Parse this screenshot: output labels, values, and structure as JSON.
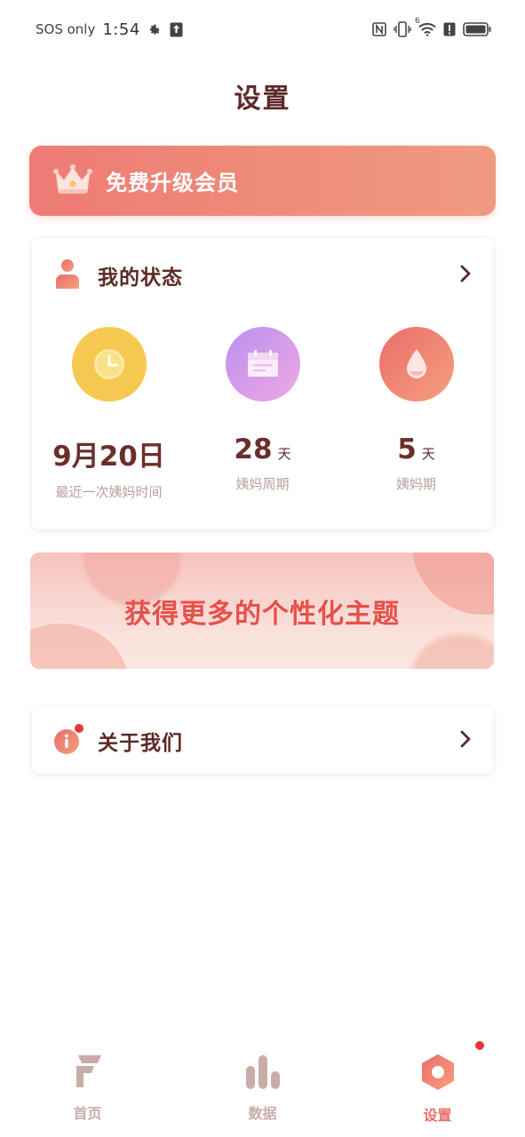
{
  "status_bar": {
    "carrier": "SOS only",
    "time": "1:54",
    "network_badge": "6"
  },
  "page": {
    "title": "设置"
  },
  "vip_banner": {
    "label": "免费升级会员"
  },
  "my_status": {
    "title": "我的状态",
    "stats": [
      {
        "value": "9月20日",
        "unit": "",
        "label": "最近一次姨妈时间",
        "icon": "clock-icon"
      },
      {
        "value": "28",
        "unit": "天",
        "label": "姨妈周期",
        "icon": "calendar-icon"
      },
      {
        "value": "5",
        "unit": "天",
        "label": "姨妈期",
        "icon": "drop-icon"
      }
    ]
  },
  "theme_banner": {
    "label": "获得更多的个性化主题"
  },
  "about": {
    "label": "关于我们"
  },
  "bottom_nav": {
    "items": [
      {
        "label": "首页",
        "icon": "home-f-icon",
        "active": false
      },
      {
        "label": "数据",
        "icon": "bar-chart-icon",
        "active": false
      },
      {
        "label": "设置",
        "icon": "settings-hexagon-icon",
        "active": true
      }
    ]
  },
  "colors": {
    "accent": "#ee7b74",
    "title_text": "#5c2a26",
    "muted_text": "#b99f9c",
    "nav_inactive": "#c9aca8",
    "nav_active": "#e5706a",
    "notification_dot": "#e5373a"
  }
}
